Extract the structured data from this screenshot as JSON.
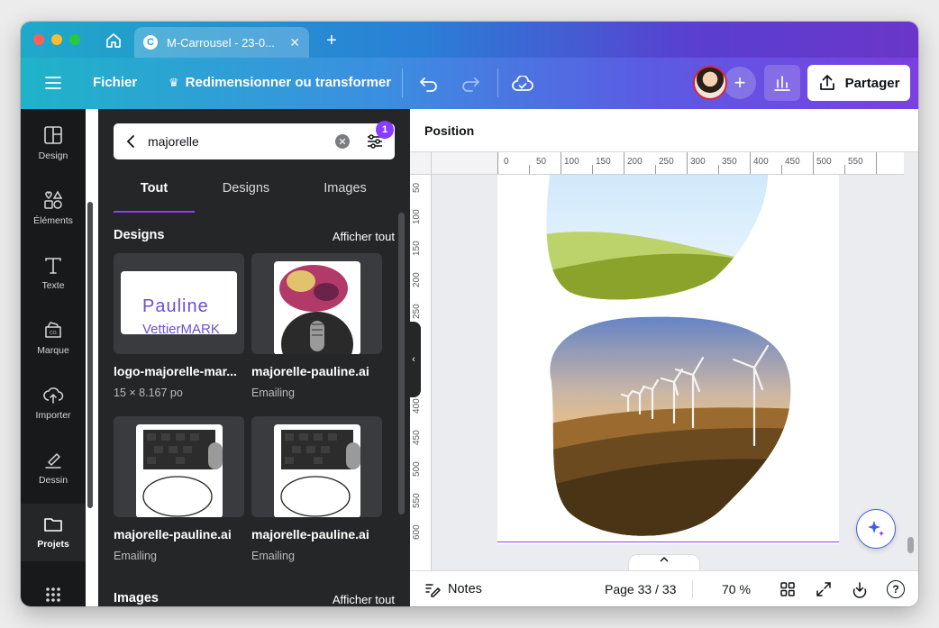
{
  "browser": {
    "tab_title": "M-Carrousel - 23-0...",
    "favicon_letter": "C"
  },
  "toolbar": {
    "file_label": "Fichier",
    "resize_label": "Redimensionner ou transformer",
    "share_label": "Partager"
  },
  "rail": {
    "items": [
      {
        "label": "Design",
        "icon": "layout-icon"
      },
      {
        "label": "Éléments",
        "icon": "shapes-icon"
      },
      {
        "label": "Texte",
        "icon": "text-icon"
      },
      {
        "label": "Marque",
        "icon": "brand-icon"
      },
      {
        "label": "Importer",
        "icon": "upload-cloud-icon"
      },
      {
        "label": "Dessin",
        "icon": "draw-icon"
      },
      {
        "label": "Projets",
        "icon": "folder-icon"
      }
    ],
    "active": "Projets"
  },
  "search": {
    "value": "majorelle",
    "filter_count": "1"
  },
  "panel_tabs": [
    {
      "label": "Tout"
    },
    {
      "label": "Designs"
    },
    {
      "label": "Images"
    }
  ],
  "designs_section": {
    "title": "Designs",
    "see_all": "Afficher tout",
    "cards": [
      {
        "title": "logo-majorelle-mar...",
        "subtitle": "15 × 8.167 po",
        "thumb_line1": "Pauline",
        "thumb_line2": "VettierMARK"
      },
      {
        "title": "majorelle-pauline.ai",
        "subtitle": "Emailing"
      },
      {
        "title": "majorelle-pauline.ai",
        "subtitle": "Emailing"
      },
      {
        "title": "majorelle-pauline.ai",
        "subtitle": "Emailing"
      }
    ]
  },
  "images_section": {
    "title": "Images",
    "see_all": "Afficher tout"
  },
  "canvas": {
    "position_label": "Position",
    "ruler_top": [
      "0",
      "50",
      "100",
      "150",
      "200",
      "250",
      "300",
      "350",
      "400",
      "450",
      "500",
      "550"
    ],
    "ruler_left": [
      "50",
      "100",
      "150",
      "200",
      "250",
      "300",
      "350",
      "400",
      "450",
      "500",
      "550",
      "600"
    ]
  },
  "footer": {
    "notes_label": "Notes",
    "page_indicator": "Page 33 / 33",
    "zoom": "70 %",
    "help": "?"
  },
  "colors": {
    "accent_purple": "#8b3dff",
    "toolbar_gradient_start": "#1fb3c9",
    "toolbar_gradient_end": "#7b3fe0",
    "panel_bg": "#252627",
    "rail_bg": "#18191b"
  }
}
